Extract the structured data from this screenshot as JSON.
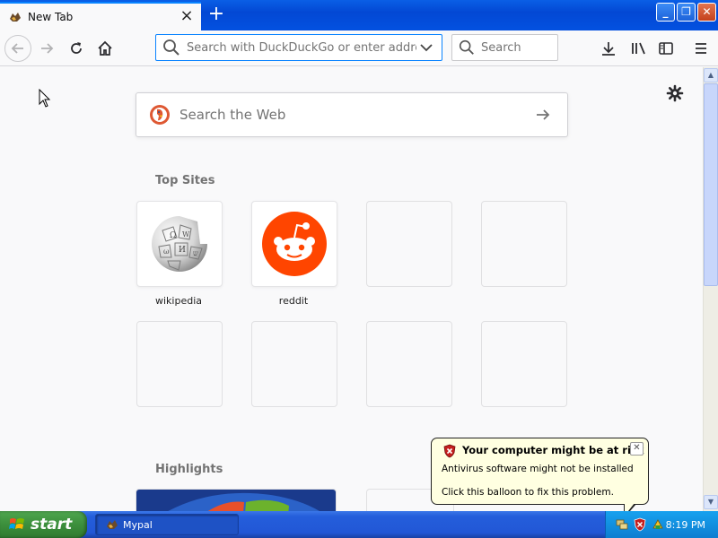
{
  "window": {
    "tab_title": "New Tab",
    "new_tab_icon": "plus-icon",
    "controls": {
      "minimize": "minimize-icon",
      "restore": "restore-icon",
      "close": "close-icon"
    }
  },
  "toolbar": {
    "url_placeholder": "Search with DuckDuckGo or enter address",
    "search_placeholder": "Search",
    "icons": [
      "back-icon",
      "forward-icon",
      "reload-icon",
      "home-icon",
      "download-icon",
      "library-icon",
      "sidebar-icon",
      "menu-icon"
    ]
  },
  "newtab": {
    "web_search_placeholder": "Search the Web",
    "top_sites_title": "Top Sites",
    "top_sites": [
      {
        "label": "wikipedia",
        "icon": "wikipedia-icon"
      },
      {
        "label": "reddit",
        "icon": "reddit-icon"
      }
    ],
    "highlights_title": "Highlights"
  },
  "balloon": {
    "title": "Your computer might be at risk",
    "line1": "Antivirus software might not be installed",
    "line2": "Click this balloon to fix this problem."
  },
  "taskbar": {
    "start_label": "start",
    "task_label": "Mypal",
    "clock": "8:19 PM"
  },
  "colors": {
    "accent": "#0a84ff",
    "reddit": "#ff4500",
    "ddg": "#de5833",
    "xp_taskbar": "#245edb",
    "xp_start": "#3c8f3c"
  }
}
